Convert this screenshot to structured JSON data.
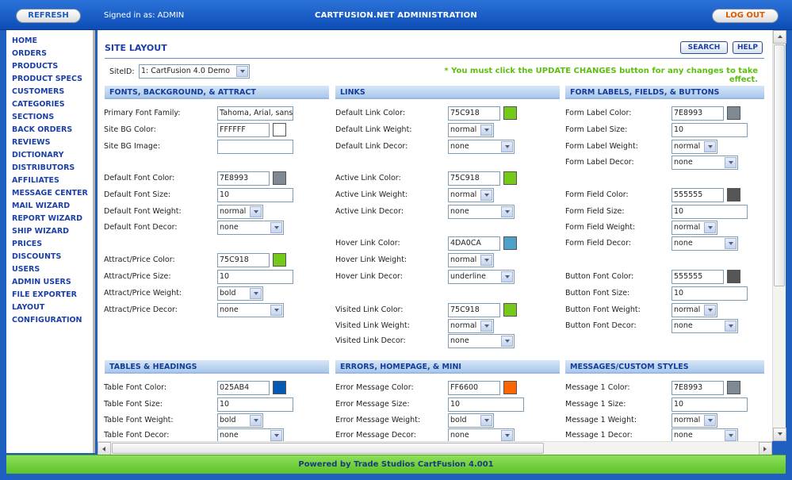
{
  "header": {
    "refresh_label": "REFRESH",
    "signed_in": "Signed in as: ADMIN",
    "title": "CARTFUSION.NET ADMINISTRATION",
    "logout_label": "LOG OUT"
  },
  "nav": [
    "HOME",
    "ORDERS",
    "PRODUCTS",
    "PRODUCT SPECS",
    "CUSTOMERS",
    "CATEGORIES",
    "SECTIONS",
    "BACK ORDERS",
    "REVIEWS",
    "DICTIONARY",
    "DISTRIBUTORS",
    "AFFILIATES",
    "MESSAGE CENTER",
    "MAIL WIZARD",
    "REPORT WIZARD",
    "SHIP WIZARD",
    "PRICES",
    "DISCOUNTS",
    "USERS",
    "ADMIN USERS",
    "FILE EXPORTER",
    "LAYOUT",
    "CONFIGURATION"
  ],
  "page": {
    "title": "SITE LAYOUT",
    "search_label": "SEARCH",
    "help_label": "HELP",
    "siteid_label": "SiteID:",
    "siteid_value": "1: CartFusion 4.0 Demo",
    "notice": "* You must click the UPDATE CHANGES button for any changes to take effect."
  },
  "sections": {
    "fonts": "FONTS, BACKGROUND, & ATTRACT",
    "links": "LINKS",
    "forms": "FORM LABELS, FIELDS, & BUTTONS",
    "tables": "TABLES & HEADINGS",
    "errors": "ERRORS, HOMEPAGE, & MINI",
    "messages": "MESSAGES/CUSTOM STYLES"
  },
  "fields": {
    "c1": [
      {
        "label": "Primary Font Family:",
        "kind": "text",
        "value": "Tahoma, Arial, sans"
      },
      {
        "label": "Site BG Color:",
        "kind": "color",
        "value": "FFFFFF",
        "swatch": "#FFFFFF"
      },
      {
        "label": "Site BG Image:",
        "kind": "text",
        "value": ""
      },
      {
        "label": "Default Font Color:",
        "kind": "color",
        "value": "7E8993",
        "swatch": "#7E8993"
      },
      {
        "label": "Default Font Size:",
        "kind": "text",
        "value": "10"
      },
      {
        "label": "Default Font Weight:",
        "kind": "select-s",
        "value": "normal"
      },
      {
        "label": "Default Font Decor:",
        "kind": "select-l",
        "value": "none"
      },
      {
        "label": "Attract/Price Color:",
        "kind": "color",
        "value": "75C918",
        "swatch": "#75C918"
      },
      {
        "label": "Attract/Price Size:",
        "kind": "text",
        "value": "10"
      },
      {
        "label": "Attract/Price Weight:",
        "kind": "select-s",
        "value": "bold"
      },
      {
        "label": "Attract/Price Decor:",
        "kind": "select-l",
        "value": "none"
      }
    ],
    "c2": [
      {
        "label": "Default Link Color:",
        "kind": "color",
        "value": "75C918",
        "swatch": "#75C918"
      },
      {
        "label": "Default Link Weight:",
        "kind": "select-s",
        "value": "normal"
      },
      {
        "label": "Default Link Decor:",
        "kind": "select-l",
        "value": "none"
      },
      {
        "label": "Active Link Color:",
        "kind": "color",
        "value": "75C918",
        "swatch": "#75C918"
      },
      {
        "label": "Active Link Weight:",
        "kind": "select-s",
        "value": "normal"
      },
      {
        "label": "Active Link Decor:",
        "kind": "select-l",
        "value": "none"
      },
      {
        "label": "Hover Link Color:",
        "kind": "color",
        "value": "4DA0CA",
        "swatch": "#4DA0CA"
      },
      {
        "label": "Hover Link Weight:",
        "kind": "select-s",
        "value": "normal"
      },
      {
        "label": "Hover Link Decor:",
        "kind": "select-l",
        "value": "underline"
      },
      {
        "label": "Visited Link Color:",
        "kind": "color",
        "value": "75C918",
        "swatch": "#75C918"
      },
      {
        "label": "Visited Link Weight:",
        "kind": "select-s",
        "value": "normal"
      },
      {
        "label": "Visited Link Decor:",
        "kind": "select-l",
        "value": "none"
      }
    ],
    "c3": [
      {
        "label": "Form Label Color:",
        "kind": "color",
        "value": "7E8993",
        "swatch": "#7E8993"
      },
      {
        "label": "Form Label Size:",
        "kind": "text",
        "value": "10"
      },
      {
        "label": "Form Label Weight:",
        "kind": "select-s",
        "value": "normal"
      },
      {
        "label": "Form Label Decor:",
        "kind": "select-l",
        "value": "none"
      },
      {
        "label": "Form Field Color:",
        "kind": "color",
        "value": "555555",
        "swatch": "#555555"
      },
      {
        "label": "Form Field Size:",
        "kind": "text",
        "value": "10"
      },
      {
        "label": "Form Field Weight:",
        "kind": "select-s",
        "value": "normal"
      },
      {
        "label": "Form Field Decor:",
        "kind": "select-l",
        "value": "none"
      },
      {
        "label": "Button Font Color:",
        "kind": "color",
        "value": "555555",
        "swatch": "#555555"
      },
      {
        "label": "Button Font Size:",
        "kind": "text",
        "value": "10"
      },
      {
        "label": "Button Font Weight:",
        "kind": "select-s",
        "value": "normal"
      },
      {
        "label": "Button Font Decor:",
        "kind": "select-l",
        "value": "none"
      }
    ],
    "t1": [
      {
        "label": "Table Font Color:",
        "kind": "color",
        "value": "025AB4",
        "swatch": "#025AB4"
      },
      {
        "label": "Table Font Size:",
        "kind": "text",
        "value": "10"
      },
      {
        "label": "Table Font Weight:",
        "kind": "select-s",
        "value": "bold"
      },
      {
        "label": "Table Font Decor:",
        "kind": "select-l",
        "value": "none"
      }
    ],
    "t2": [
      {
        "label": "Error Message Color:",
        "kind": "color",
        "value": "FF6600",
        "swatch": "#FF6600"
      },
      {
        "label": "Error Message Size:",
        "kind": "text",
        "value": "10"
      },
      {
        "label": "Error Message Weight:",
        "kind": "select-s",
        "value": "bold"
      },
      {
        "label": "Error Message Decor:",
        "kind": "select-l",
        "value": "none"
      }
    ],
    "t3": [
      {
        "label": "Message 1 Color:",
        "kind": "color",
        "value": "7E8993",
        "swatch": "#7E8993"
      },
      {
        "label": "Message 1 Size:",
        "kind": "text",
        "value": "10"
      },
      {
        "label": "Message 1 Weight:",
        "kind": "select-s",
        "value": "normal"
      },
      {
        "label": "Message 1 Decor:",
        "kind": "select-l",
        "value": "none"
      }
    ]
  },
  "footer": "Powered by Trade Studios CartFusion 4.001"
}
